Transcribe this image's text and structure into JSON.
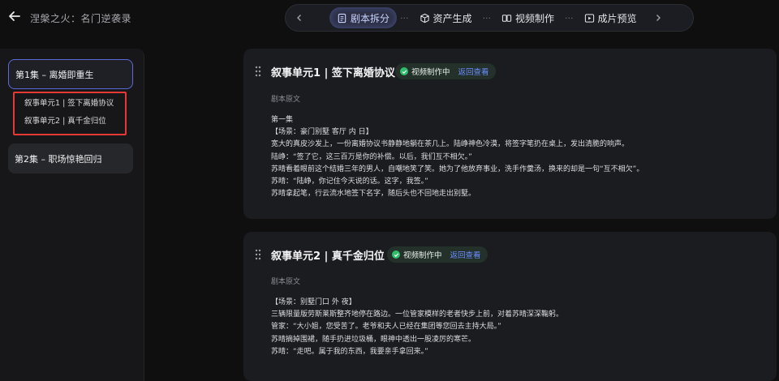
{
  "header": {
    "app_title": "涅槃之火：名门逆袭录"
  },
  "nav": {
    "tabs": [
      {
        "label": "剧本拆分",
        "icon": "document-icon",
        "active": true
      },
      {
        "label": "资产生成",
        "icon": "cube-icon",
        "active": false
      },
      {
        "label": "视频制作",
        "icon": "film-icon",
        "active": false
      },
      {
        "label": "成片预览",
        "icon": "play-icon",
        "active": false
      }
    ],
    "separator": "···"
  },
  "sidebar": {
    "episodes": [
      {
        "label": "第1集 – 离婚即重生"
      },
      {
        "label": "第2集 – 职场惊艳回归"
      }
    ],
    "sub_items": [
      {
        "label": "叙事单元1 | 签下离婚协议"
      },
      {
        "label": "叙事单元2 | 真千金归位"
      }
    ]
  },
  "units": [
    {
      "title": "叙事单元1 | 签下离婚协议",
      "status": "视频制作中",
      "link": "返回查看",
      "section_label": "剧本原文",
      "lines": [
        "第一集",
        "【场景：豪门别墅 客厅 内 日】",
        "宽大的真皮沙发上，一份离婚协议书静静地躺在茶几上。陆峥神色冷漠，将签字笔扔在桌上，发出清脆的响声。",
        "陆峥：“签了它，这三百万是你的补偿。以后，我们互不相欠。”",
        "苏晴看着眼前这个结婚三年的男人，自嘲地笑了笑。她为了他放弃事业，洗手作羹汤，换来的却是一句“互不相欠”。",
        "苏晴：“陆峥，你记住今天说的话。这字，我签。”",
        "苏晴拿起笔，行云流水地签下名字，随后头也不回地走出别墅。"
      ]
    },
    {
      "title": "叙事单元2 | 真千金归位",
      "status": "视频制作中",
      "link": "返回查看",
      "section_label": "剧本原文",
      "lines": [
        "【场景：别墅门口 外 夜】",
        "三辆限量版劳斯莱斯整齐地停在路边。一位管家模样的老者快步上前，对着苏晴深深鞠躬。",
        "管家：“大小姐，您受苦了。老爷和夫人已经在集团等您回去主持大局。”",
        "苏晴摘掉围裙，随手扔进垃圾桶，眼神中透出一股凌厉的寒芒。",
        "苏晴：“走吧。属于我的东西，我要亲手拿回来。”"
      ]
    }
  ],
  "colors": {
    "accent": "#5b6ad8",
    "status_green": "#2ebd6b",
    "link_blue": "#6c8cff",
    "highlight_red": "#e53935"
  }
}
